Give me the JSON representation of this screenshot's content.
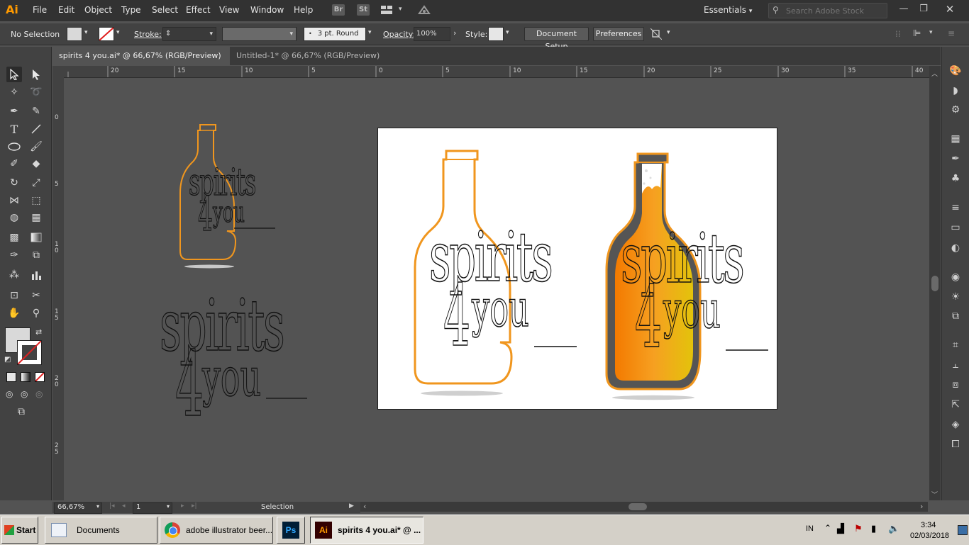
{
  "app": {
    "logo": "Ai",
    "menus": [
      "File",
      "Edit",
      "Object",
      "Type",
      "Select",
      "Effect",
      "View",
      "Window",
      "Help"
    ],
    "bridge_label": "Br",
    "stock_label": "St",
    "workspace": "Essentials",
    "search_placeholder": "Search Adobe Stock"
  },
  "controlbar": {
    "selection_status": "No Selection",
    "stroke_label": "Stroke:",
    "brush_profile": "3 pt. Round",
    "opacity_label": "Opacity:",
    "opacity_value": "100%",
    "style_label": "Style:",
    "document_setup": "Document Setup",
    "preferences": "Preferences"
  },
  "tabs": [
    {
      "label": "spirits 4 you.ai* @ 66,67% (RGB/Preview)",
      "close": "✕"
    },
    {
      "label": "Untitled-1* @ 66,67% (RGB/Preview)",
      "close": "✕"
    }
  ],
  "ruler": {
    "h_ticks": [
      "20",
      "15",
      "10",
      "5",
      "0",
      "5",
      "10",
      "15",
      "20",
      "25",
      "30",
      "35",
      "40"
    ],
    "v_ticks": [
      "0",
      "5",
      "1\n0",
      "1\n5",
      "2\n0",
      "2\n5"
    ]
  },
  "artwork": {
    "word1": "spirits",
    "word2": "you",
    "numeral": "4"
  },
  "colors": {
    "accent_orange": "#f0961e",
    "beer_orange": "#f39c12",
    "beer_gold": "#e3c30b",
    "ai_brand": "#ff9a00"
  },
  "status": {
    "zoom": "66,67%",
    "artboard_number": "1",
    "mode": "Selection"
  },
  "taskbar": {
    "start": "Start",
    "items": [
      {
        "label": "Documents"
      },
      {
        "label": "adobe illustrator beer..."
      },
      {
        "label": "Ps"
      },
      {
        "label": "spirits 4 you.ai* @ ..."
      }
    ],
    "lang": "IN",
    "time": "3:34",
    "date": "02/03/2018"
  }
}
